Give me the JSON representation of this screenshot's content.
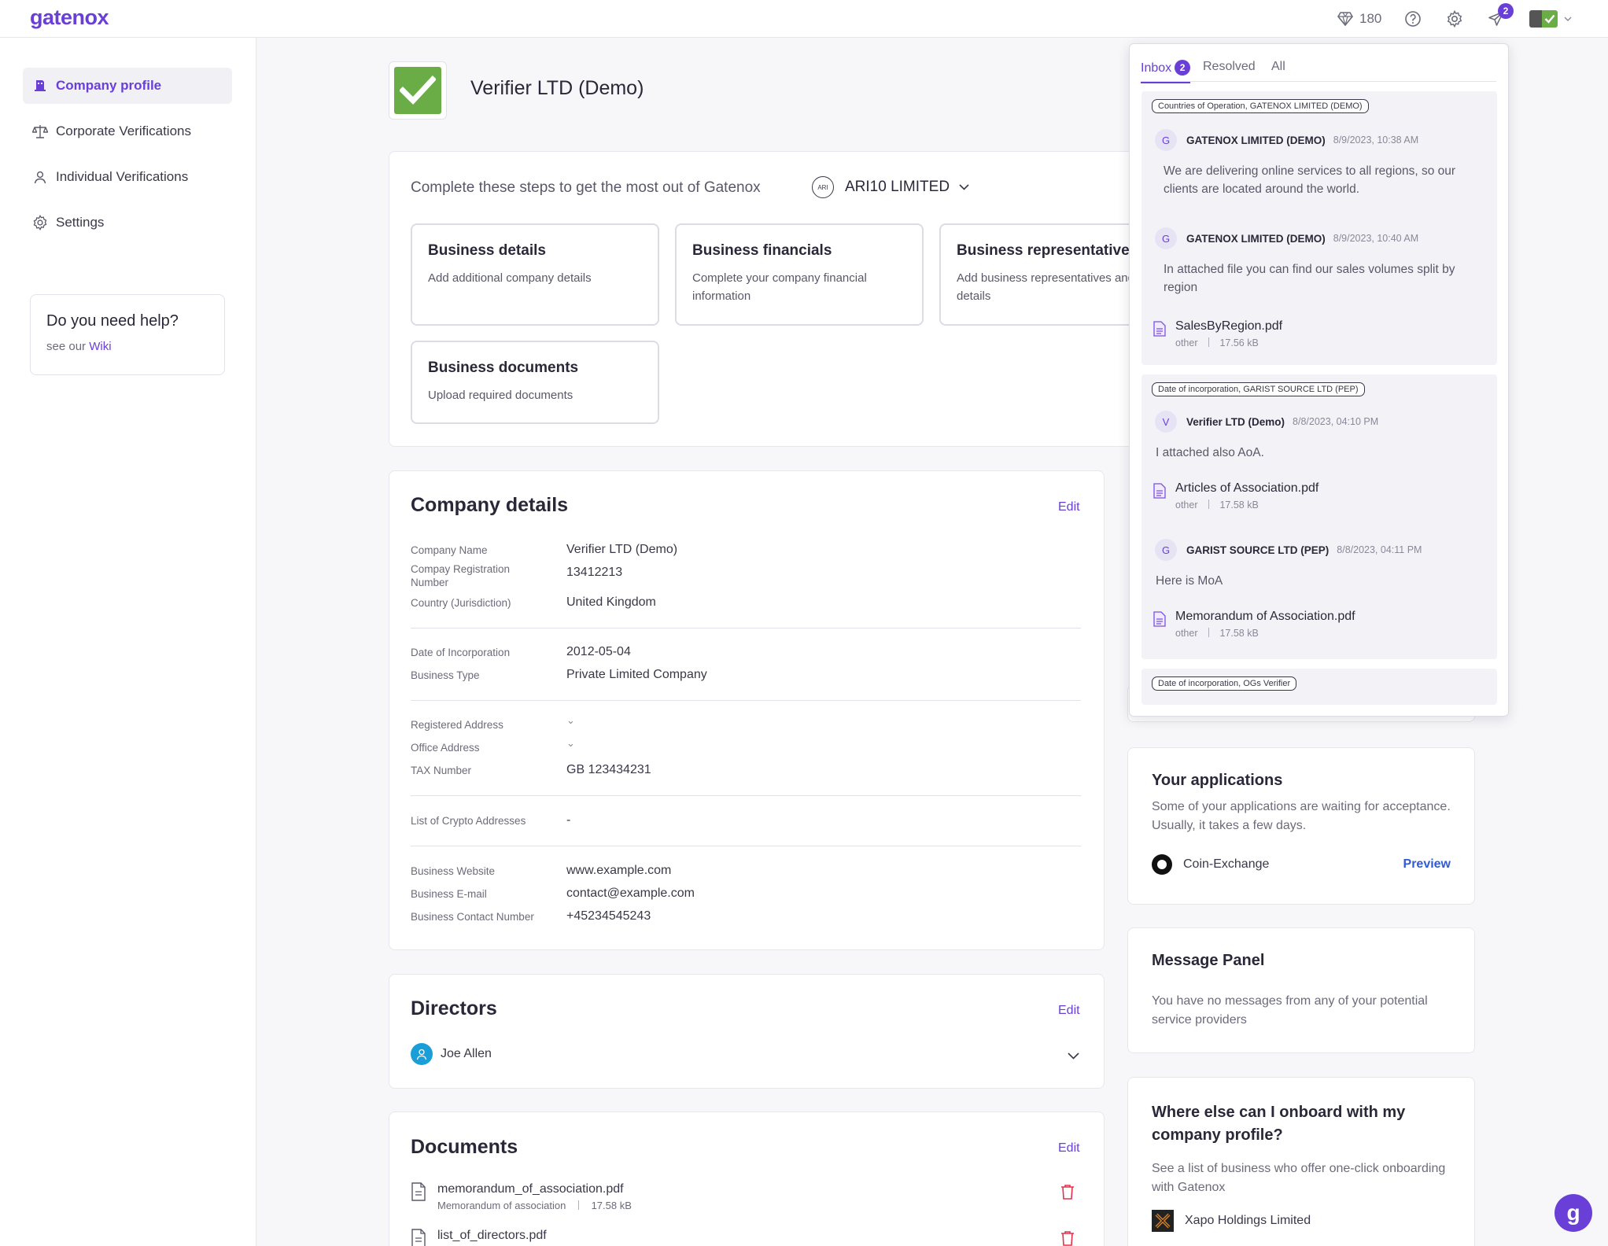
{
  "header": {
    "logo": "gatenox",
    "credits": "180",
    "notifications_count": "2"
  },
  "sidebar": {
    "items": [
      {
        "label": "Company profile",
        "icon": "building-icon",
        "active": true
      },
      {
        "label": "Corporate Verifications",
        "icon": "scales-icon",
        "active": false
      },
      {
        "label": "Individual Verifications",
        "icon": "person-icon",
        "active": false
      },
      {
        "label": "Settings",
        "icon": "gear-icon",
        "active": false
      }
    ],
    "help": {
      "title": "Do you need help?",
      "prefix": "see our",
      "link": "Wiki"
    }
  },
  "profile": {
    "company_name": "Verifier LTD (Demo)"
  },
  "steps": {
    "intro": "Complete these steps to get the most out of Gatenox",
    "selected_company": "ARI10 LIMITED",
    "cards": [
      {
        "title": "Business details",
        "desc": "Add additional company details"
      },
      {
        "title": "Business financials",
        "desc": "Complete your company financial information"
      },
      {
        "title": "Business representatives",
        "desc": "Add business representatives and their details"
      },
      {
        "title": "Business documents",
        "desc": "Upload required documents"
      }
    ]
  },
  "company_details": {
    "title": "Company details",
    "edit": "Edit",
    "rows": [
      {
        "label": "Company Name",
        "value": "Verifier LTD (Demo)"
      },
      {
        "label": "Compay Registration Number",
        "value": "13412213"
      },
      {
        "label": "Country (Jurisdiction)",
        "value": "United Kingdom"
      },
      {
        "label": "Date of Incorporation",
        "value": "2012-05-04"
      },
      {
        "label": "Business Type",
        "value": "Private Limited Company"
      },
      {
        "label": "Registered Address",
        "value": "⌄"
      },
      {
        "label": "Office Address",
        "value": "⌄"
      },
      {
        "label": "TAX Number",
        "value": "GB 123434231"
      },
      {
        "label": "List of Crypto Addresses",
        "value": "-"
      },
      {
        "label": "Business Website",
        "value": "www.example.com"
      },
      {
        "label": "Business E-mail",
        "value": "contact@example.com"
      },
      {
        "label": "Business Contact Number",
        "value": "+45234545243"
      }
    ]
  },
  "directors": {
    "title": "Directors",
    "edit": "Edit",
    "items": [
      {
        "name": "Joe Allen"
      }
    ]
  },
  "documents": {
    "title": "Documents",
    "edit": "Edit",
    "items": [
      {
        "name": "memorandum_of_association.pdf",
        "type": "Memorandum of association",
        "size": "17.58 kB"
      },
      {
        "name": "list_of_directors.pdf",
        "type": "",
        "size": ""
      }
    ]
  },
  "applications": {
    "title": "Your applications",
    "desc": "Some of your applications are waiting for acceptance. Usually, it takes a few days.",
    "item": "Coin-Exchange",
    "preview": "Preview"
  },
  "message_panel": {
    "title": "Message Panel",
    "desc": "You have no messages from any of your potential service providers"
  },
  "onboard": {
    "title": "Where else can I onboard with my company profile?",
    "desc": "See a list of business who offer one-click onboarding with Gatenox",
    "item": "Xapo Holdings Limited"
  },
  "inbox": {
    "tabs": [
      {
        "label": "Inbox",
        "badge": "2"
      },
      {
        "label": "Resolved"
      },
      {
        "label": "All"
      }
    ],
    "threads": [
      {
        "tag": "Countries of Operation, GATENOX LIMITED (DEMO)",
        "messages": [
          {
            "initial": "G",
            "author": "GATENOX LIMITED (DEMO)",
            "time": "8/9/2023, 10:38 AM",
            "text": "We are delivering online services to all regions, so our clients are located around the world."
          },
          {
            "initial": "G",
            "author": "GATENOX LIMITED (DEMO)",
            "time": "8/9/2023, 10:40 AM",
            "text": "In attached file you can find our sales volumes split by region"
          }
        ],
        "attachment": {
          "name": "SalesByRegion.pdf",
          "type": "other",
          "size": "17.56 kB"
        }
      },
      {
        "tag": "Date of incorporation, GARIST SOURCE LTD (PEP)",
        "messages": [
          {
            "initial": "V",
            "author": "Verifier LTD (Demo)",
            "time": "8/8/2023, 04:10 PM",
            "text": "I attached also AoA."
          },
          {
            "initial": "G",
            "author": "GARIST SOURCE LTD (PEP)",
            "time": "8/8/2023, 04:11 PM",
            "text": "Here is MoA"
          }
        ],
        "attachments": [
          {
            "name": "Articles of Association.pdf",
            "type": "other",
            "size": "17.58 kB"
          },
          {
            "name": "Memorandum of Association.pdf",
            "type": "other",
            "size": "17.58 kB"
          }
        ]
      },
      {
        "tag": "Date of incorporation, OGs Verifier"
      }
    ]
  },
  "colors": {
    "accent": "#6a3fd8",
    "success": "#6aad46",
    "danger": "#e0334a"
  }
}
